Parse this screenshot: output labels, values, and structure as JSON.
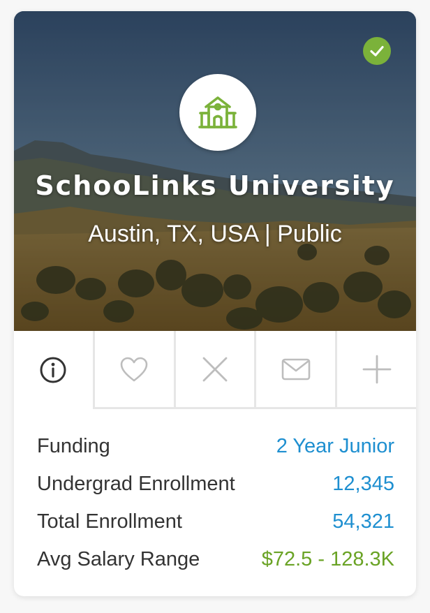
{
  "school": {
    "name": "SchooLinks University",
    "subtitle": "Austin, TX, USA | Public",
    "verified": true
  },
  "icons": {
    "verified": "check-icon",
    "logo": "school-building-icon",
    "tabs": [
      "info-icon",
      "heart-icon",
      "close-icon",
      "mail-icon",
      "plus-icon"
    ]
  },
  "tabs": {
    "active_index": 0
  },
  "details": [
    {
      "label": "Funding",
      "value": "2 Year Junior",
      "color": "#1e8fd0"
    },
    {
      "label": "Undergrad Enrollment",
      "value": "12,345",
      "color": "#1e8fd0"
    },
    {
      "label": "Total Enrollment",
      "value": "54,321",
      "color": "#1e8fd0"
    },
    {
      "label": "Avg Salary Range",
      "value": "$72.5 - 128.3K",
      "color": "#6aa325"
    }
  ],
  "colors": {
    "accent_green": "#7bb23a",
    "link_blue": "#1e8fd0",
    "salary_green": "#6aa325",
    "icon_gray": "#bdbdbd",
    "icon_dark": "#333333"
  }
}
